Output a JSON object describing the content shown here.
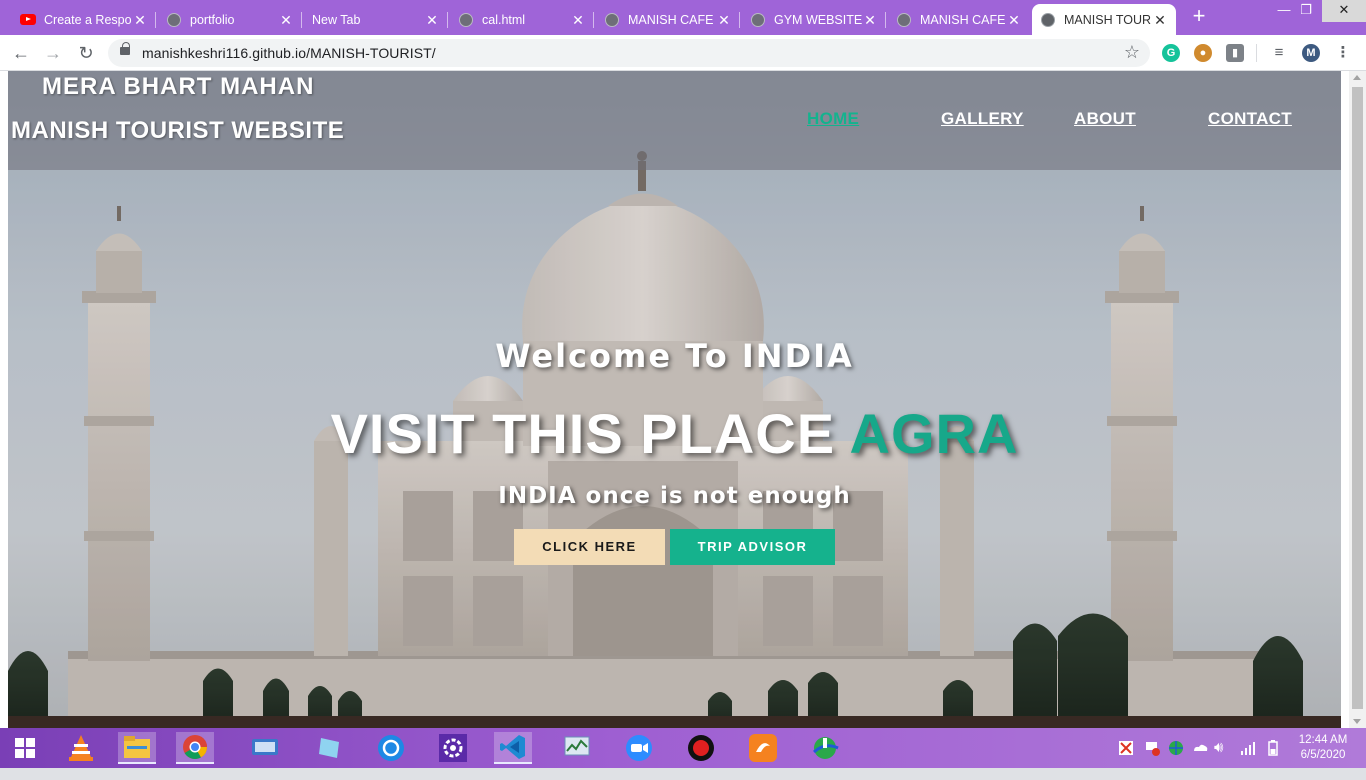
{
  "browser": {
    "tabs": [
      {
        "title": "Create a Respo",
        "favicon": "youtube-icon"
      },
      {
        "title": "portfolio",
        "favicon": "globe-icon"
      },
      {
        "title": "New Tab",
        "favicon": ""
      },
      {
        "title": "cal.html",
        "favicon": "globe-icon"
      },
      {
        "title": "MANISH CAFE",
        "favicon": "globe-icon"
      },
      {
        "title": "GYM WEBSITE",
        "favicon": "globe-icon"
      },
      {
        "title": "MANISH CAFE",
        "favicon": "globe-icon"
      },
      {
        "title": "MANISH TOUR",
        "favicon": "globe-icon",
        "active": true
      }
    ],
    "url": "manishkeshri116.github.io/MANISH-TOURIST/",
    "colors": {
      "tabstrip": "#9f64d8",
      "accent_green": "#17a88a"
    }
  },
  "site": {
    "brand_line1": "MERA BHART MAHAN",
    "brand_line2": "MANISH TOURIST WEBSITE",
    "nav": [
      "HOME",
      "GALLERY",
      "ABOUT",
      "CONTACT"
    ],
    "welcome": "Welcome To INDIA",
    "headline_prefix": "VISIT THIS PLACE",
    "headline_accent": "AGRA",
    "tagline": "INDIA once is not enough",
    "btn_primary": "CLICK HERE",
    "btn_secondary": "TRIP ADVISOR"
  },
  "taskbar": {
    "time": "12:44 AM",
    "date": "6/5/2020"
  }
}
